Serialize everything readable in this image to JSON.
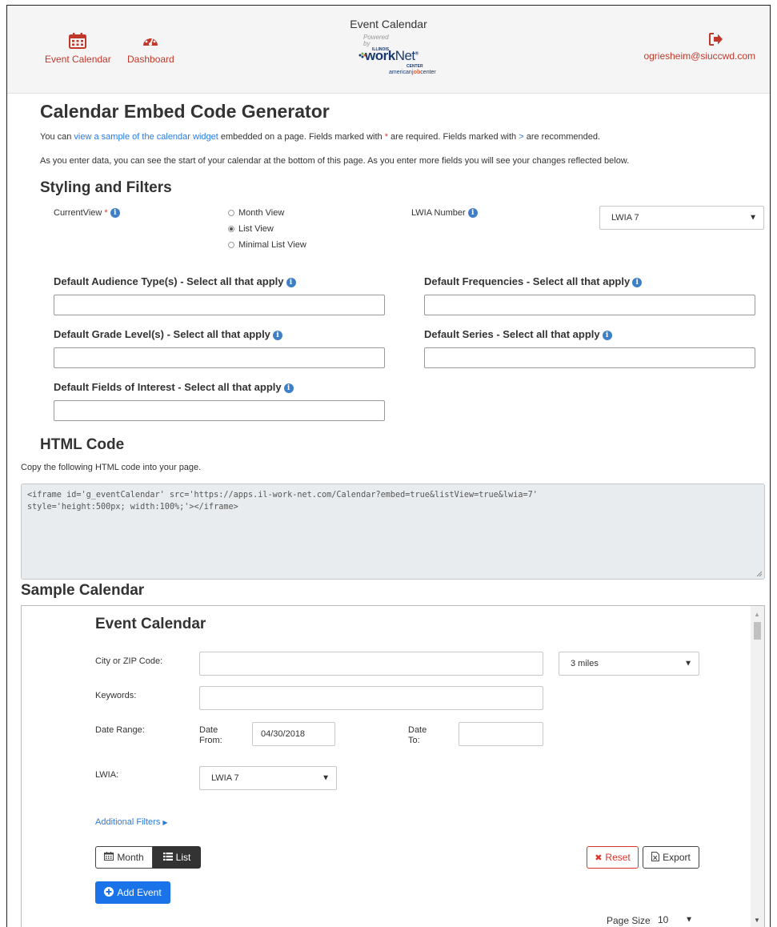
{
  "header": {
    "title": "Event Calendar",
    "nav_calendar": "Event Calendar",
    "nav_dashboard": "Dashboard",
    "user_email": "ogriesheim@siuccwd.com",
    "logo": {
      "powered": "Powered",
      "by": "by",
      "illinois": "ILLINOIS",
      "work": "work",
      "net": "Net",
      "center": "CENTER",
      "american": "american",
      "job": "job",
      "centerword": "center"
    }
  },
  "page": {
    "title": "Calendar Embed Code Generator",
    "intro1_a": "You can ",
    "intro1_link": "view a sample of the calendar widget",
    "intro1_b": " embedded on a page. Fields marked with ",
    "intro1_star": "*",
    "intro1_c": " are required. Fields marked with ",
    "intro1_gt": ">",
    "intro1_d": " are recommended.",
    "intro2": "As you enter data, you can see the start of your calendar at the bottom of this page. As you enter more fields you will see your changes reflected below."
  },
  "styling": {
    "heading": "Styling and Filters",
    "current_view_label": "CurrentView",
    "required_star": "*",
    "view_options": [
      "Month View",
      "List View",
      "Minimal List View"
    ],
    "selected_view": "List View",
    "lwia_label": "LWIA Number",
    "lwia_value": "LWIA 7",
    "audience_label": "Default Audience Type(s) - Select all that apply",
    "frequencies_label": "Default Frequencies - Select all that apply",
    "grade_label": "Default Grade Level(s) - Select all that apply",
    "series_label": "Default Series - Select all that apply",
    "interest_label": "Default Fields of Interest - Select all that apply"
  },
  "html_code": {
    "heading": "HTML Code",
    "instruction": "Copy the following HTML code into your page.",
    "line1": "<iframe id='g_eventCalendar' src='https://apps.il-work-net.com/Calendar?embed=true&listView=true&lwia=7'",
    "line2": "style='height:500px; width:100%;'></iframe>"
  },
  "sample": {
    "heading": "Sample Calendar",
    "title": "Event Calendar",
    "city_label": "City or ZIP Code:",
    "distance_value": "3 miles",
    "keywords_label": "Keywords:",
    "date_range_label": "Date Range:",
    "date_from_label_1": "Date",
    "date_from_label_2": "From:",
    "date_from_value": "04/30/2018",
    "date_to_label_1": "Date",
    "date_to_label_2": "To:",
    "lwia_label": "LWIA:",
    "lwia_value": "LWIA 7",
    "additional_filters": "Additional Filters",
    "month_button": "Month",
    "list_button": "List",
    "reset_button": "Reset",
    "export_button": "Export",
    "add_event_button": "Add Event",
    "page_size_label": "Page Size:",
    "page_size_value": "10"
  },
  "colors": {
    "accent_red": "#c0392b",
    "link_blue": "#2a7ae2",
    "primary_blue": "#1a73e8",
    "info_blue": "#3f7fc7"
  }
}
